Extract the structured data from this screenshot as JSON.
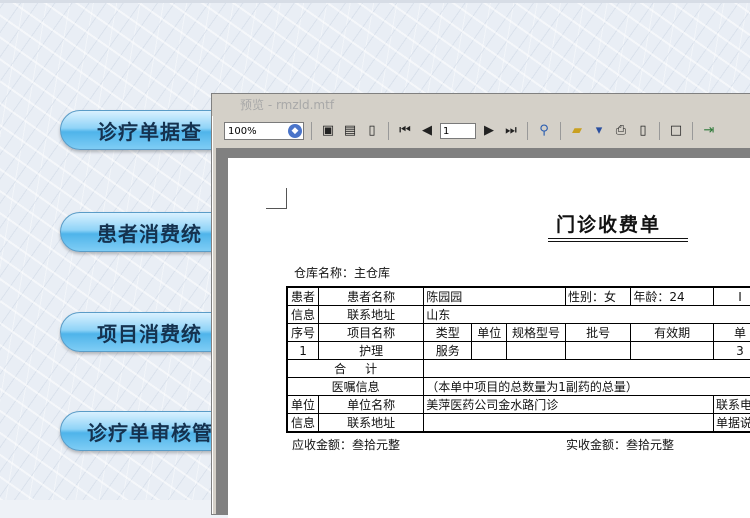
{
  "nav": {
    "items": [
      {
        "label": "诊疗单据查"
      },
      {
        "label": "患者消费统"
      },
      {
        "label": "项目消费统"
      },
      {
        "label": "诊疗单审核管"
      }
    ]
  },
  "window": {
    "title": "预览 - rmzld.mtf",
    "toolbar": {
      "zoom": "100%",
      "page": "1",
      "icons": [
        "page-view-icon",
        "page-width-icon",
        "page-full-icon",
        "first-page-icon",
        "prev-page-icon",
        "next-page-icon",
        "last-page-icon",
        "find-icon",
        "open-icon",
        "save-icon",
        "print-icon",
        "page-setup-icon",
        "stop-icon",
        "exit-icon"
      ]
    }
  },
  "doc": {
    "title": "门诊收费单",
    "warehouse": "仓库名称：主仓库",
    "patient": {
      "group_label_1": "患者",
      "group_label_2": "信息",
      "name_label": "患者名称",
      "name_value": "陈园园",
      "sex": "性别：女",
      "age": "年龄：24",
      "extra": "I",
      "address_label": "联系地址",
      "address_value": "山东"
    },
    "headers": [
      "序号",
      "项目名称",
      "类型",
      "单位",
      "规格型号",
      "批号",
      "有效期",
      "单"
    ],
    "rows": [
      {
        "no": "1",
        "name": "护理",
        "type": "服务",
        "unit": "",
        "spec": "",
        "batch": "",
        "expiry": "",
        "price": "3"
      }
    ],
    "total_label": "合     计",
    "advice_label": "医嘱信息",
    "advice_value": "（本单中项目的总数量为1副药的总量）",
    "unit": {
      "group_label_1": "单位",
      "group_label_2": "信息",
      "name_label": "单位名称",
      "name_value": "美萍医药公司金水路门诊",
      "phone_label": "联系电话",
      "address_label": "联系地址",
      "address_value": "",
      "note_label": "单据说明"
    },
    "receivable": "应收金额：叁拾元整",
    "received": "实收金额：叁拾元整"
  }
}
